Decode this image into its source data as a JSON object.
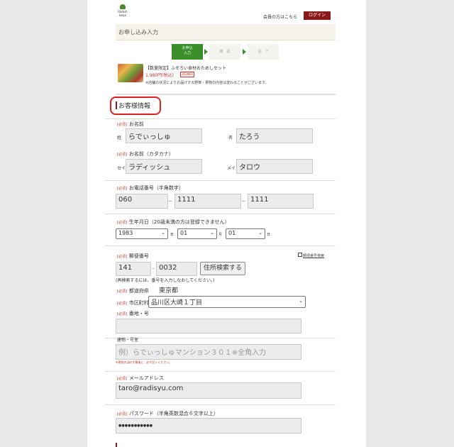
{
  "header": {
    "logo_text": "Radish boya",
    "member_text": "会員の方はこちら",
    "login_label": "ログイン"
  },
  "page_title": "お申し込み入力",
  "steps": [
    {
      "label": "お申込\n入力",
      "active": true
    },
    {
      "label": "確　認",
      "active": false
    },
    {
      "label": "完　了",
      "active": false
    }
  ],
  "product": {
    "title": "【数量限定】ふぞろい食材おためしセット",
    "price": "1,980円(税込)",
    "badge": "送料無料",
    "note": "※店舗の状況によりお届けする野菜・果物の内容は変わることがございます。"
  },
  "section_title": "お客様情報",
  "required_label": "[必須]",
  "name": {
    "label": "お名前",
    "last_prefix": "姓",
    "first_prefix": "名",
    "last_value": "らでぃっしゅ",
    "first_value": "たろう"
  },
  "kana": {
    "label": "お名前（カタカナ）",
    "last_prefix": "セイ",
    "first_prefix": "メイ",
    "last_value": "ラディッシュ",
    "first_value": "タロウ"
  },
  "phone": {
    "label": "お電話番号（半角数字）",
    "values": [
      "060",
      "1111",
      "1111"
    ],
    "separator": "－"
  },
  "birthday": {
    "label": "生年月日（20歳未満の方は登録できません）",
    "year": "1983",
    "month": "01",
    "day": "01",
    "year_unit": "年",
    "month_unit": "月",
    "day_unit": "日"
  },
  "postal": {
    "label": "郵便番号",
    "search_link": "郵便番号検索",
    "first": "141",
    "second": "0032",
    "separator": "-",
    "button_label": "住所検索する",
    "note": "(再検索するには、番号を入力しなおしてください。)"
  },
  "prefecture": {
    "label": "都道府県",
    "value": "東京都"
  },
  "city": {
    "label": "市区町村",
    "value": "品川区大崎１丁目"
  },
  "street": {
    "label": "番地・号",
    "value": ""
  },
  "building": {
    "label": "建物・号室",
    "placeholder": "例）らでぃっしゅマンション３０１※全角入力",
    "note": "※建物名は必ず最後に、必ず記入ください。"
  },
  "email": {
    "label": "メールアドレス",
    "value": "taro@radisyu.com"
  },
  "password": {
    "label": "パスワード（半角英数混合６文字以上）",
    "value": "●●●●●●●●●●●"
  },
  "colors": {
    "accent": "#8b1a1a",
    "step_active": "#3a8f2a",
    "highlight_ring": "#e02020"
  }
}
